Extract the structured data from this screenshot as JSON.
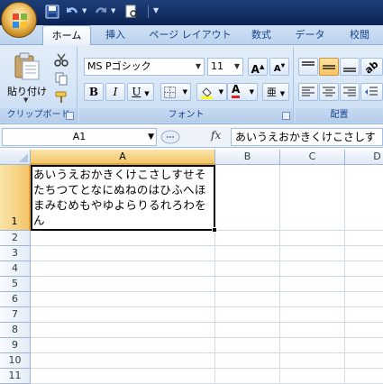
{
  "ribbon": {
    "tabs": [
      "ホーム",
      "挿入",
      "ページ レイアウト",
      "数式",
      "データ",
      "校閲"
    ],
    "clipboard": {
      "paste_label": "貼り付け",
      "group_label": "クリップボード"
    },
    "font": {
      "name": "MS Pゴシック",
      "size": "11",
      "group_label": "フォント"
    },
    "alignment": {
      "group_label": "配置"
    }
  },
  "formula_bar": {
    "name_box": "A1",
    "fx_label": "fx",
    "content": "あいうえおかきくけこさしす"
  },
  "sheet": {
    "columns": [
      "A",
      "B",
      "C",
      "D"
    ],
    "rows": [
      "1",
      "2",
      "3",
      "4",
      "5",
      "6",
      "7",
      "8",
      "9",
      "10",
      "11"
    ],
    "cell_a1": "あいうえおかきくけこさしすせそたちつてとなにぬねのはひふへほまみむめもやゆよらりるれろわをん"
  }
}
